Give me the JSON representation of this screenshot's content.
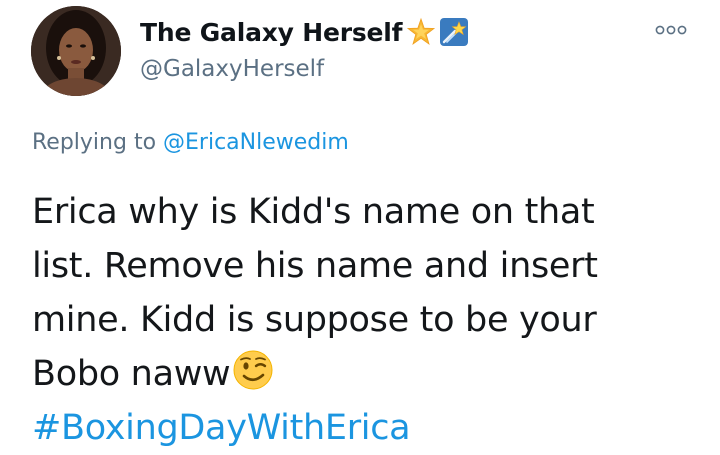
{
  "user": {
    "display_name": "The Galaxy Herself",
    "handle": "@GalaxyHerself",
    "badges": [
      "star-emoji",
      "shooting-star-emoji"
    ]
  },
  "more_icon": "more-options-icon",
  "reply": {
    "prefix": "Replying to ",
    "to": "@EricaNlewedim"
  },
  "tweet": {
    "lines": [
      "Erica why is Kidd's name on that",
      "list. Remove his name and insert",
      "mine. Kidd is suppose to be your",
      "Bobo naww"
    ],
    "emoji": "winking-face-emoji",
    "hashtag": "#BoxingDayWithErica"
  },
  "colors": {
    "link": "#1b95e0",
    "secondary_text": "#5b7083",
    "primary_text": "#14171a"
  }
}
